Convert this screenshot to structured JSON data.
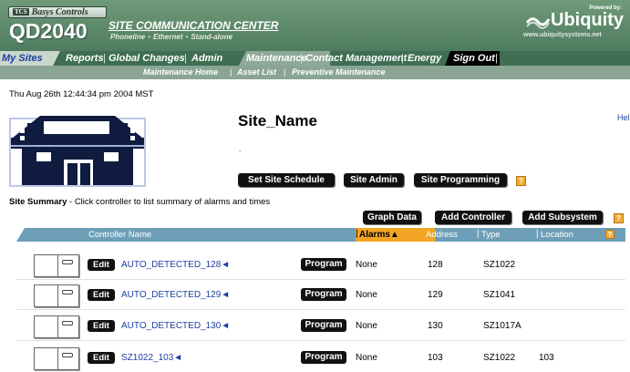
{
  "header": {
    "brand_badge_prefix": "TCS",
    "brand_badge": "Basys Controls",
    "product": "QD2040",
    "center_title": "SITE COMMUNICATION CENTER",
    "center_sub": [
      "Phoneline",
      "Ethernet",
      "Stand-alone"
    ],
    "logo_powered": "Powered by:",
    "logo_name": "Ubiquity",
    "logo_url": "www.ubiquitysystems.net"
  },
  "nav": {
    "items": [
      "My Sites",
      "Reports",
      "Global Changes",
      "Admin",
      "Maintenance",
      "Contact Management",
      "Energy",
      "Sign Out"
    ]
  },
  "subnav": {
    "items": [
      "Maintenance Home",
      "Asset List",
      "Preventive Maintenance"
    ]
  },
  "timestamp": "Thu Aug 26th 12:44:34 pm 2004 MST",
  "site": {
    "name": "Site_Name",
    "dot": ".",
    "help": "Hel"
  },
  "buttons": {
    "set_schedule": "Set Site Schedule",
    "site_admin": "Site Admin",
    "site_programming": "Site Programming",
    "graph_data": "Graph Data",
    "add_controller": "Add Controller",
    "add_subsystem": "Add Subsystem",
    "help_glyph": "?"
  },
  "summary": {
    "title": "Site Summary",
    "text": " - Click controller to list summary of alarms and times"
  },
  "table": {
    "headers": {
      "controller": "Controller Name",
      "alarms": "Alarms▲",
      "address": "Address",
      "type": "Type",
      "location": "Location"
    },
    "edit_label": "Edit",
    "program_label": "Program",
    "rows": [
      {
        "name": "AUTO_DETECTED_128◄",
        "alarms": "None",
        "address": "128",
        "type": "SZ1022",
        "location": ""
      },
      {
        "name": "AUTO_DETECTED_129◄",
        "alarms": "None",
        "address": "129",
        "type": "SZ1041",
        "location": ""
      },
      {
        "name": "AUTO_DETECTED_130◄",
        "alarms": "None",
        "address": "130",
        "type": "SZ1017A",
        "location": ""
      },
      {
        "name": "SZ1022_103◄",
        "alarms": "None",
        "address": "103",
        "type": "SZ1022",
        "location": "103"
      }
    ]
  },
  "colors": {
    "header_green": "#4f7b5f",
    "nav_green": "#3f6e52",
    "table_header_blue": "#6da0b8",
    "sorted_column_orange": "#f2a524",
    "link_blue": "#1d3fa3"
  }
}
